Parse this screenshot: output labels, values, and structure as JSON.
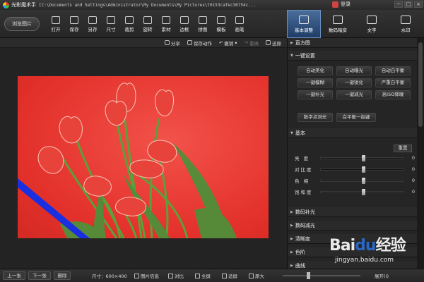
{
  "window": {
    "app_name": "光影魔术手",
    "path": "[C:\\Documents and Settings\\Administrator\\My Documents\\My Pictures\\t0153cafec36754c...",
    "login_label": "登录",
    "controls": [
      "－",
      "□",
      "×"
    ]
  },
  "toolbar": {
    "browse_label": "浏览图片",
    "tools": [
      {
        "label": "打开",
        "icon": "open-icon"
      },
      {
        "label": "保存",
        "icon": "save-icon"
      },
      {
        "label": "另存",
        "icon": "save-as-icon"
      },
      {
        "label": "尺寸",
        "icon": "resize-icon",
        "dropdown": true
      },
      {
        "label": "裁剪",
        "icon": "crop-icon",
        "dropdown": true
      },
      {
        "label": "旋转",
        "icon": "rotate-icon",
        "dropdown": true
      },
      {
        "label": "素材",
        "icon": "material-icon"
      },
      {
        "label": "边框",
        "icon": "border-icon"
      },
      {
        "label": "拼图",
        "icon": "collage-icon"
      },
      {
        "label": "模板",
        "icon": "template-icon"
      },
      {
        "label": "画笔",
        "icon": "brush-icon",
        "dropdown": true
      }
    ],
    "right_tabs": [
      {
        "label": "基本调整",
        "icon": "adjust-icon",
        "active": true
      },
      {
        "label": "数码暗房",
        "icon": "camera-icon",
        "active": false
      },
      {
        "label": "文字",
        "icon": "text-icon",
        "active": false
      },
      {
        "label": "水印",
        "icon": "watermark-icon",
        "active": false
      }
    ]
  },
  "subbar": {
    "share": "分享",
    "save_action": "保存动作",
    "undo": "撤销",
    "redo": "重做",
    "restore": "还原"
  },
  "panel": {
    "histogram": "直方图",
    "one_click": "一键设置",
    "one_click_buttons": [
      "自动美化",
      "自动曝光",
      "自动白平衡",
      "一键模糊",
      "一键锐化",
      "严重白平衡",
      "一键补光",
      "一键减光",
      "高ISO降噪"
    ],
    "extra_buttons": [
      "数字点测光",
      "白平衡一指键"
    ],
    "basic": "基本",
    "reset": "重置",
    "sliders": [
      {
        "name": "亮 度",
        "value": 0,
        "level": 0.5
      },
      {
        "name": "对比度",
        "value": 0,
        "level": 0.5
      },
      {
        "name": "色 相",
        "value": 0,
        "level": 0.5
      },
      {
        "name": "饱和度",
        "value": 0,
        "level": 0.5
      }
    ],
    "collapsed_sections": [
      "数码补光",
      "数码减光",
      "清晰度",
      "色阶",
      "曲线"
    ]
  },
  "statusbar": {
    "prev": "上一张",
    "next": "下一张",
    "delete": "删除",
    "size": "尺寸：600×400",
    "info": "图片信息",
    "compare": "对比",
    "fullscreen": "全屏",
    "fit": "适屏",
    "original": "原大",
    "expand": "展开(I)"
  },
  "watermark": {
    "brand_bai": "Bai",
    "brand_du": "du",
    "brand_cn": "经验",
    "url": "jingyan.baidu.com"
  },
  "colors": {
    "photo_bg": "#e3302a",
    "active_tab": "#2f5385",
    "stripe": "#1a2fe0"
  }
}
